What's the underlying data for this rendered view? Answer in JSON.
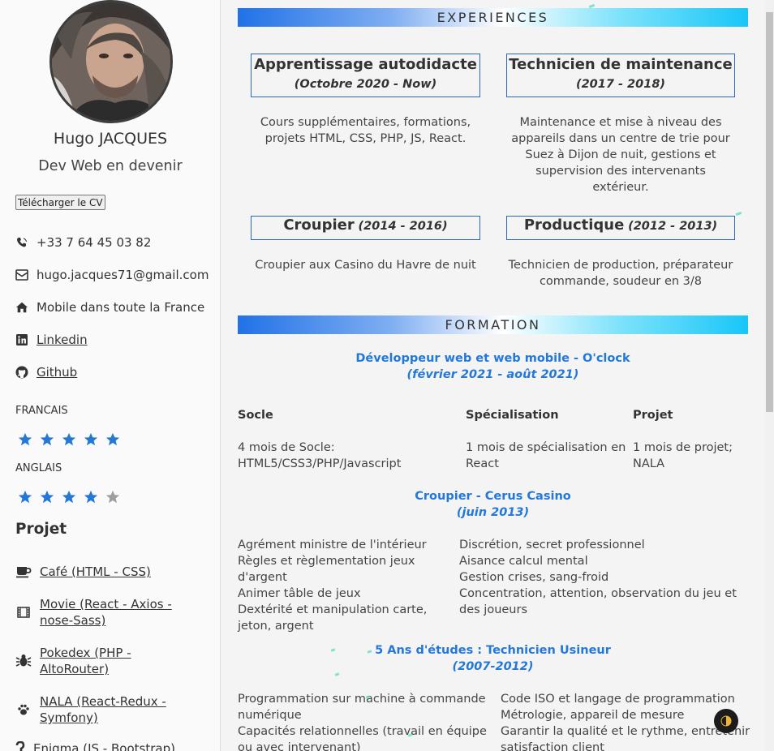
{
  "profile": {
    "name": "Hugo JACQUES",
    "subtitle": "Dev Web en devenir",
    "cv_button": "Télécharger le CV"
  },
  "contact": {
    "phone": "+33 7 64 45 03 82",
    "email": "hugo.jacques71@gmail.com",
    "location": "Mobile dans toute la France",
    "linkedin": "Linkedin",
    "github": "Github"
  },
  "languages": [
    {
      "name": "FRANCAIS",
      "rating": 5,
      "max": 5
    },
    {
      "name": "ANGLAIS",
      "rating": 4,
      "max": 5
    }
  ],
  "projects": {
    "title": "Projet",
    "items": [
      {
        "label": "Café (HTML - CSS)",
        "icon": "coffee-icon"
      },
      {
        "label": "Movie (React - Axios - nose-Sass)",
        "icon": "film-icon"
      },
      {
        "label": "Pokedex (PHP - AltoRouter)",
        "icon": "bug-icon"
      },
      {
        "label": "NALA (React-Redux - Symfony)",
        "icon": "paw-icon"
      },
      {
        "label": "Enigma (JS - Bootstrap)",
        "icon": "question-icon"
      }
    ]
  },
  "experiences": {
    "title": "EXPERIENCES",
    "items": [
      {
        "title": "Apprentissage autodidacte",
        "date": "(Octobre 2020 - Now)",
        "desc": "Cours supplémentaires, formations, projets HTML, CSS, PHP, JS, React."
      },
      {
        "title": "Technicien de maintenance",
        "date": "(2017 - 2018)",
        "desc": "Maintenance et mise à niveau des appareils dans un centre de trie pour Suez à Dijon de nuit, gestions et supervision des intervenants extérieur."
      },
      {
        "title": "Croupier",
        "date": "(2014 - 2016)",
        "desc": "Croupier aux Casino du Havre de nuit"
      },
      {
        "title": "Productique",
        "date": "(2012 - 2013)",
        "desc": "Technicien de production, préparateur commande, soudeur en 3/8"
      }
    ]
  },
  "formation": {
    "title": "FORMATION",
    "items": [
      {
        "title": "Développeur web et web mobile - O'clock",
        "date": "(février 2021 - août 2021)",
        "headers": [
          "Socle",
          "Spécialisation",
          "Projet"
        ],
        "cols": [
          "4 mois de Socle: HTML5/CSS3/PHP/Javascript",
          "1 mois de spécialisation en React",
          "1 mois de projet; NALA"
        ]
      },
      {
        "title": "Croupier - Cerus Casino",
        "date": "(juin 2013)",
        "left": [
          "Agrément ministre de l'intérieur",
          "Règles et règlementation jeux d'argent",
          "Animer tâble de jeux",
          "Dextérité et manipulation carte, jeton, argent"
        ],
        "right": [
          "Discrétion, secret professionnel",
          "Aisance calcul mental",
          "Gestion crises, sang-froid",
          "Concentration, attention, observation du jeu et des joueurs"
        ]
      },
      {
        "title": "5 Ans d'études : Technicien Usineur",
        "date": "(2007-2012)",
        "left": [
          "Programmation sur machine à commande numérique",
          "Capacités relationnelles (travail en équipe ou avec intervenant)"
        ],
        "right": [
          "Code ISO et langage de programmation",
          "Métrologie, appareil de mesure",
          "Garantir la qualité et le rythme, entretenir satisfaction client"
        ]
      }
    ]
  },
  "colors": {
    "accent_blue": "#2378d8",
    "star_on": "#2378d8",
    "star_off": "#9e9e9e",
    "border": "#2a68b7"
  }
}
